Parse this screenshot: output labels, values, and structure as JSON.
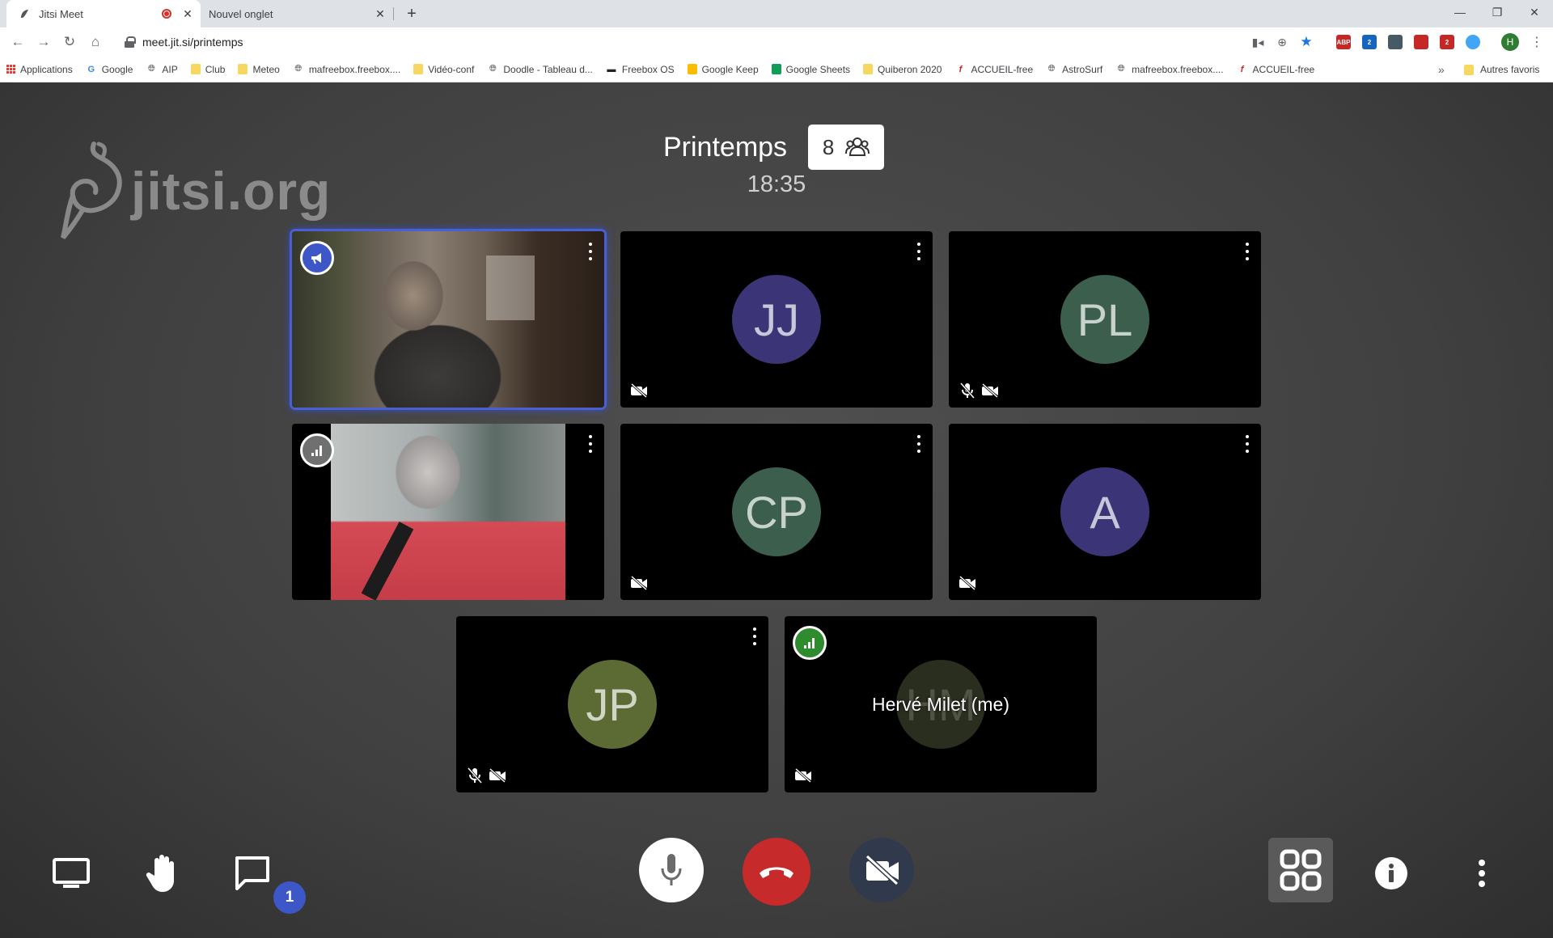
{
  "browser": {
    "tabs": [
      {
        "title": "Jitsi Meet",
        "active": true
      },
      {
        "title": "Nouvel onglet",
        "active": false
      }
    ],
    "url": "meet.jit.si/printemps",
    "bookmarks": [
      {
        "label": "Applications",
        "icon": "apps-grid-icon"
      },
      {
        "label": "Google",
        "icon": "google-icon"
      },
      {
        "label": "AIP",
        "icon": "globe-icon"
      },
      {
        "label": "Club",
        "icon": "folder-icon"
      },
      {
        "label": "Meteo",
        "icon": "folder-icon"
      },
      {
        "label": "mafreebox.freebox....",
        "icon": "globe-icon"
      },
      {
        "label": "Vidéo-conf",
        "icon": "folder-icon"
      },
      {
        "label": "Doodle - Tableau d...",
        "icon": "globe-icon"
      },
      {
        "label": "Freebox OS",
        "icon": "freebox-icon"
      },
      {
        "label": "Google Keep",
        "icon": "keep-icon"
      },
      {
        "label": "Google Sheets",
        "icon": "sheets-icon"
      },
      {
        "label": "Quiberon 2020",
        "icon": "folder-icon"
      },
      {
        "label": "ACCUEIL-free",
        "icon": "free-icon"
      },
      {
        "label": "AstroSurf",
        "icon": "globe-icon"
      },
      {
        "label": "mafreebox.freebox....",
        "icon": "globe-icon"
      },
      {
        "label": "ACCUEIL-free",
        "icon": "free-icon"
      }
    ],
    "bookmarks_more": "»",
    "other_bookmarks": "Autres favoris",
    "extensions": [
      {
        "label": "ABP",
        "color": "#c62828"
      },
      {
        "label": "2",
        "color": "#1565c0"
      },
      {
        "label": "",
        "color": "#455a64"
      },
      {
        "label": "",
        "color": "#c62828"
      },
      {
        "label": "2",
        "color": "#c62828"
      },
      {
        "label": "",
        "color": "#42a5f5"
      }
    ],
    "profile_initial": "H"
  },
  "watermark": "jitsi.org",
  "meeting": {
    "room_name": "Printemps",
    "participant_count": "8",
    "elapsed": "18:35"
  },
  "tiles": [
    {
      "id": "video-1",
      "initials": "",
      "video": true,
      "dominant": true,
      "badge": "speaker",
      "mic_muted": false,
      "cam_off": false
    },
    {
      "id": "jj",
      "initials": "JJ",
      "avatar_color": "#3b3578",
      "mic_muted": false,
      "cam_off": true
    },
    {
      "id": "pl",
      "initials": "PL",
      "avatar_color": "#3c5e4c",
      "mic_muted": true,
      "cam_off": true
    },
    {
      "id": "video-2",
      "initials": "",
      "video": true,
      "badge": "quality-grey",
      "mic_muted": false,
      "cam_off": false
    },
    {
      "id": "cp",
      "initials": "CP",
      "avatar_color": "#3c5e4c",
      "mic_muted": false,
      "cam_off": true
    },
    {
      "id": "a",
      "initials": "A",
      "avatar_color": "#3b3578",
      "mic_muted": false,
      "cam_off": true
    },
    {
      "id": "jp",
      "initials": "JP",
      "avatar_color": "#5c6a34",
      "mic_muted": true,
      "cam_off": true
    },
    {
      "id": "me",
      "initials": "HM",
      "avatar_color": "#2a2e1e",
      "display_name": "Hervé Milet (me)",
      "badge": "quality-green",
      "mic_muted": false,
      "cam_off": true
    }
  ],
  "toolbar": {
    "chat_unread": "1"
  },
  "colors": {
    "accent": "#3d56c8",
    "hangup": "#c62a2a",
    "camera_off_bg": "#31394d"
  }
}
